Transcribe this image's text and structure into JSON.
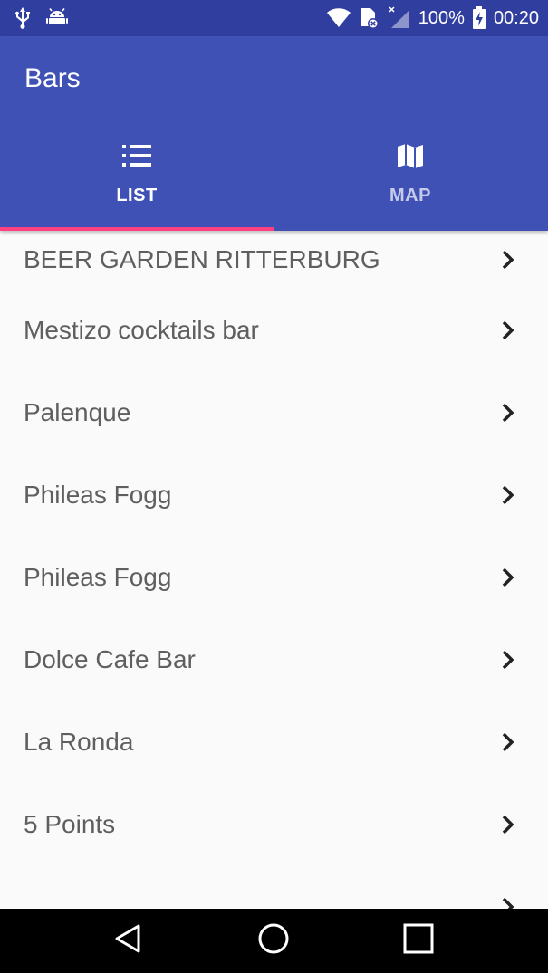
{
  "status_bar": {
    "battery_percent": "100%",
    "time": "00:20",
    "icons": [
      "usb-icon",
      "android-debug-icon",
      "wifi-icon",
      "no-sim-icon",
      "signal-icon",
      "battery-charging-icon"
    ]
  },
  "app_bar": {
    "title": "Bars",
    "background_color": "#3f51b5",
    "status_color": "#303f9f",
    "accent_color": "#ff4081"
  },
  "tabs": [
    {
      "label": "LIST",
      "icon": "list-icon",
      "selected": true
    },
    {
      "label": "MAP",
      "icon": "map-icon",
      "selected": false
    }
  ],
  "bars": [
    {
      "name": "BEER GARDEN RITTERBURG"
    },
    {
      "name": "Mestizo cocktails bar"
    },
    {
      "name": "Palenque"
    },
    {
      "name": "Phileas Fogg"
    },
    {
      "name": "Phileas Fogg"
    },
    {
      "name": "Dolce Cafe Bar"
    },
    {
      "name": "La Ronda"
    },
    {
      "name": "5 Points"
    }
  ],
  "nav_bar": {
    "buttons": [
      "back-icon",
      "home-icon",
      "recents-icon"
    ]
  }
}
